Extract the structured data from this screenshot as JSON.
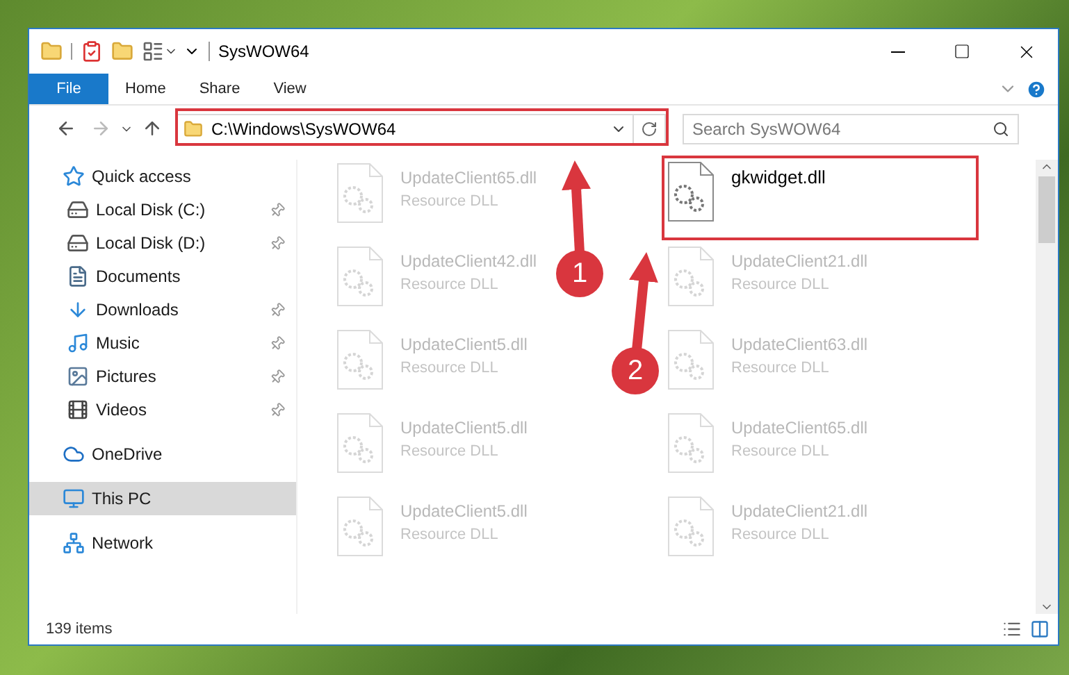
{
  "window": {
    "title": "SysWOW64"
  },
  "ribbon_tabs": [
    {
      "label": "File",
      "kind": "file"
    },
    {
      "label": "Home",
      "kind": "tab"
    },
    {
      "label": "Share",
      "kind": "tab"
    },
    {
      "label": "View",
      "kind": "tab"
    }
  ],
  "address_bar": {
    "path": "C:\\Windows\\SysWOW64"
  },
  "search": {
    "placeholder": "Search SysWOW64"
  },
  "sidebar": {
    "items": [
      {
        "label": "Quick access",
        "kind": "star",
        "selected": false,
        "children": [
          {
            "label": "Local Disk (C:)",
            "kind": "disk",
            "pinned": true,
            "selected": false
          },
          {
            "label": "Local Disk (D:)",
            "kind": "disk",
            "pinned": true,
            "selected": false
          },
          {
            "label": "Documents",
            "kind": "documents",
            "selected": false
          },
          {
            "label": "Downloads",
            "kind": "downloads",
            "pinned": true,
            "selected": false
          },
          {
            "label": "Music",
            "kind": "music",
            "pinned": true,
            "selected": false
          },
          {
            "label": "Pictures",
            "kind": "pictures",
            "pinned": true,
            "selected": false
          },
          {
            "label": "Videos",
            "kind": "videos",
            "pinned": true,
            "selected": false
          }
        ]
      },
      {
        "label": "OneDrive",
        "kind": "cloud",
        "selected": false
      },
      {
        "label": "This PC",
        "kind": "pc",
        "selected": true
      },
      {
        "label": "Network",
        "kind": "network",
        "selected": false
      }
    ]
  },
  "files": [
    {
      "name": "UpdateClient65.dll",
      "type": "Resource DLL",
      "dimmed": true
    },
    {
      "name": "gkwidget.dll",
      "dimmed": false,
      "highlighted": true
    },
    {
      "name": "UpdateClient42.dll",
      "type": "Resource DLL",
      "dimmed": true
    },
    {
      "name": "UpdateClient21.dll",
      "type": "Resource DLL",
      "dimmed": true
    },
    {
      "name": "UpdateClient5.dll",
      "type": "Resource DLL",
      "dimmed": true
    },
    {
      "name": "UpdateClient63.dll",
      "type": "Resource DLL",
      "dimmed": true
    },
    {
      "name": "UpdateClient5.dll",
      "type": "Resource DLL",
      "dimmed": true
    },
    {
      "name": "UpdateClient65.dll",
      "type": "Resource DLL",
      "dimmed": true
    },
    {
      "name": "UpdateClient5.dll",
      "type": "Resource DLL",
      "dimmed": true
    },
    {
      "name": "UpdateClient21.dll",
      "type": "Resource DLL",
      "dimmed": true
    }
  ],
  "status_bar": {
    "item_count": "139 items"
  },
  "annotations": [
    {
      "label": "1"
    },
    {
      "label": "2"
    }
  ]
}
